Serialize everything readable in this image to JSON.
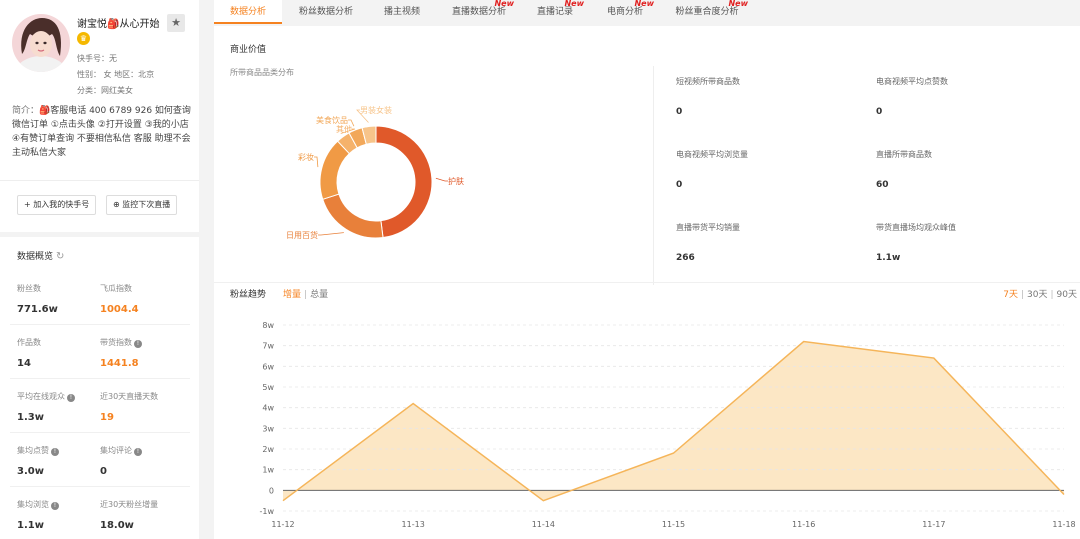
{
  "profile": {
    "name": "谢宝悦🎒从心开始",
    "kuaishou_id": "快手号：无",
    "gender_region": "性别：  女    地区：北京",
    "category": "分类：网红美女",
    "bio_label": "简介：",
    "bio_text": "🎒客服电话 400 6789 926 如何查询微信订单 ①点击头像 ②打开设置 ③我的小店 ④有赞订单查询 不要相信私信 客服 助理不会主动私信大家"
  },
  "actions": {
    "follow_label": "+ 加入我的快手号",
    "monitor_label": "⊕ 监控下次直播"
  },
  "overview": {
    "title": "数据概览",
    "stats": [
      {
        "label": "粉丝数",
        "value": "771.6w",
        "highlight": false,
        "info": false
      },
      {
        "label": "飞瓜指数",
        "value": "1004.4",
        "highlight": true,
        "info": false
      },
      {
        "label": "作品数",
        "value": "14",
        "highlight": false,
        "info": false
      },
      {
        "label": "带货指数",
        "value": "1441.8",
        "highlight": true,
        "info": true
      },
      {
        "label": "平均在线观众",
        "value": "1.3w",
        "highlight": false,
        "info": true
      },
      {
        "label": "近30天直播天数",
        "value": "19",
        "highlight": true,
        "info": false
      },
      {
        "label": "集均点赞",
        "value": "3.0w",
        "highlight": false,
        "info": true
      },
      {
        "label": "集均评论",
        "value": "0",
        "highlight": false,
        "info": true
      },
      {
        "label": "集均浏览",
        "value": "1.1w",
        "highlight": false,
        "info": true
      },
      {
        "label": "近30天粉丝增量",
        "value": "18.0w",
        "highlight": false,
        "info": false
      }
    ]
  },
  "tabs": [
    {
      "label": "数据分析",
      "active": true,
      "new": false
    },
    {
      "label": "粉丝数据分析",
      "active": false,
      "new": false
    },
    {
      "label": "播主视频",
      "active": false,
      "new": false
    },
    {
      "label": "直播数据分析",
      "active": false,
      "new": true
    },
    {
      "label": "直播记录",
      "active": false,
      "new": true
    },
    {
      "label": "电商分析",
      "active": false,
      "new": true
    },
    {
      "label": "粉丝重合度分析",
      "active": false,
      "new": true
    }
  ],
  "new_badge": "New",
  "commerce": {
    "title": "商业价值",
    "subtitle": "所带商品品类分布",
    "kpis": [
      {
        "label": "短视频所带商品数",
        "value": "0"
      },
      {
        "label": "电商视频平均点赞数",
        "value": "0"
      },
      {
        "label": "电商视频平均浏览量",
        "value": "0"
      },
      {
        "label": "直播所带商品数",
        "value": "60"
      },
      {
        "label": "直播带货平均销量",
        "value": "266"
      },
      {
        "label": "带货直播场均观众峰值",
        "value": "1.1w"
      }
    ]
  },
  "trend": {
    "title": "粉丝趋势",
    "mode_on": "增量",
    "mode_sep": "|",
    "mode_off": "总量",
    "ranges": [
      "7天",
      "30天",
      "90天"
    ],
    "range_sep": "|"
  },
  "chart_data": [
    {
      "type": "pie",
      "title": "所带商品品类分布",
      "categories": [
        "护肤",
        "日用百货",
        "彩妆",
        "其他",
        "美食饮品",
        "男装女装"
      ],
      "values": [
        48,
        22,
        18,
        4,
        4,
        4
      ],
      "colors": [
        "#e0592a",
        "#e8803a",
        "#f09a45",
        "#f5b26b",
        "#f2a85a",
        "#f7c48a"
      ]
    },
    {
      "type": "area",
      "title": "粉丝趋势",
      "x": [
        "11-12",
        "11-13",
        "11-14",
        "11-15",
        "11-16",
        "11-17",
        "11-18"
      ],
      "series": [
        {
          "values": [
            -0.5,
            4.2,
            -0.5,
            1.8,
            7.2,
            6.4,
            -0.2
          ]
        }
      ],
      "ylim": [
        -1,
        8
      ],
      "yticks": [
        "-1w",
        "0",
        "1w",
        "2w",
        "3w",
        "4w",
        "5w",
        "6w",
        "7w",
        "8w"
      ],
      "grid": true,
      "line_color": "#f5b55a",
      "fill_color": "#fbe3bb"
    }
  ]
}
